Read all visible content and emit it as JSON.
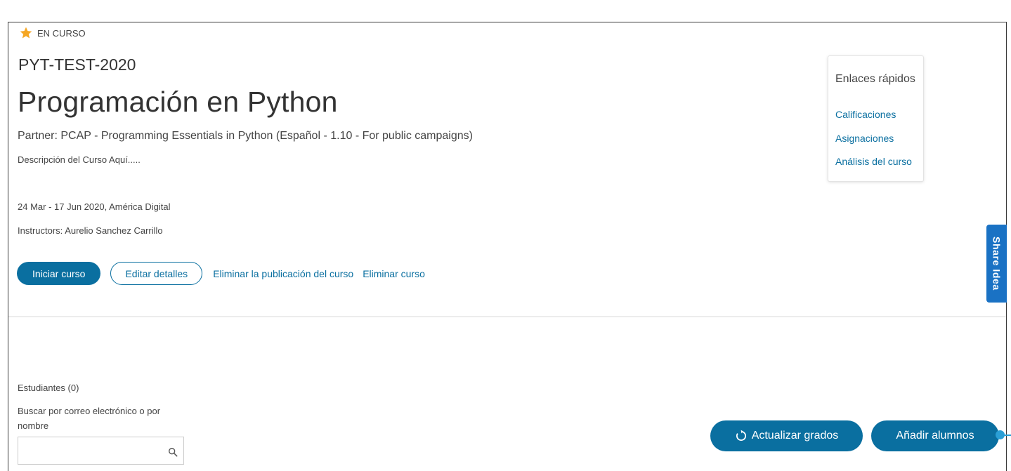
{
  "status": {
    "label": "EN CURSO",
    "icon": "star-icon",
    "icon_color": "#f5a623"
  },
  "course": {
    "code": "PYT-TEST-2020",
    "title": "Programación en Python",
    "partner": "Partner: PCAP - Programming Essentials in Python (Español - 1.10 - For public campaigns)",
    "description": "Descripción del Curso Aquí.....",
    "dates": "24 Mar - 17 Jun 2020, América Digital",
    "instructors": "Instructors: Aurelio Sanchez Carrillo"
  },
  "actions": {
    "start": "Iniciar curso",
    "edit": "Editar detalles",
    "unpublish": "Eliminar la publicación del curso",
    "delete": "Eliminar curso"
  },
  "quick_links": {
    "title": "Enlaces rápidos",
    "items": [
      {
        "label": "Calificaciones"
      },
      {
        "label": "Asignaciones"
      },
      {
        "label": "Análisis del curso"
      }
    ]
  },
  "share_tab": {
    "label": "Share Idea"
  },
  "students": {
    "title": "Estudiantes (0)",
    "search_label": "Buscar por correo electrónico o por nombre",
    "search_value": "",
    "search_placeholder": ""
  },
  "buttons": {
    "refresh": "Actualizar grados",
    "add": "Añadir alumnos"
  },
  "colors": {
    "primary": "#0a6fa0",
    "share_tab": "#1a72c4",
    "star": "#f5a623"
  }
}
